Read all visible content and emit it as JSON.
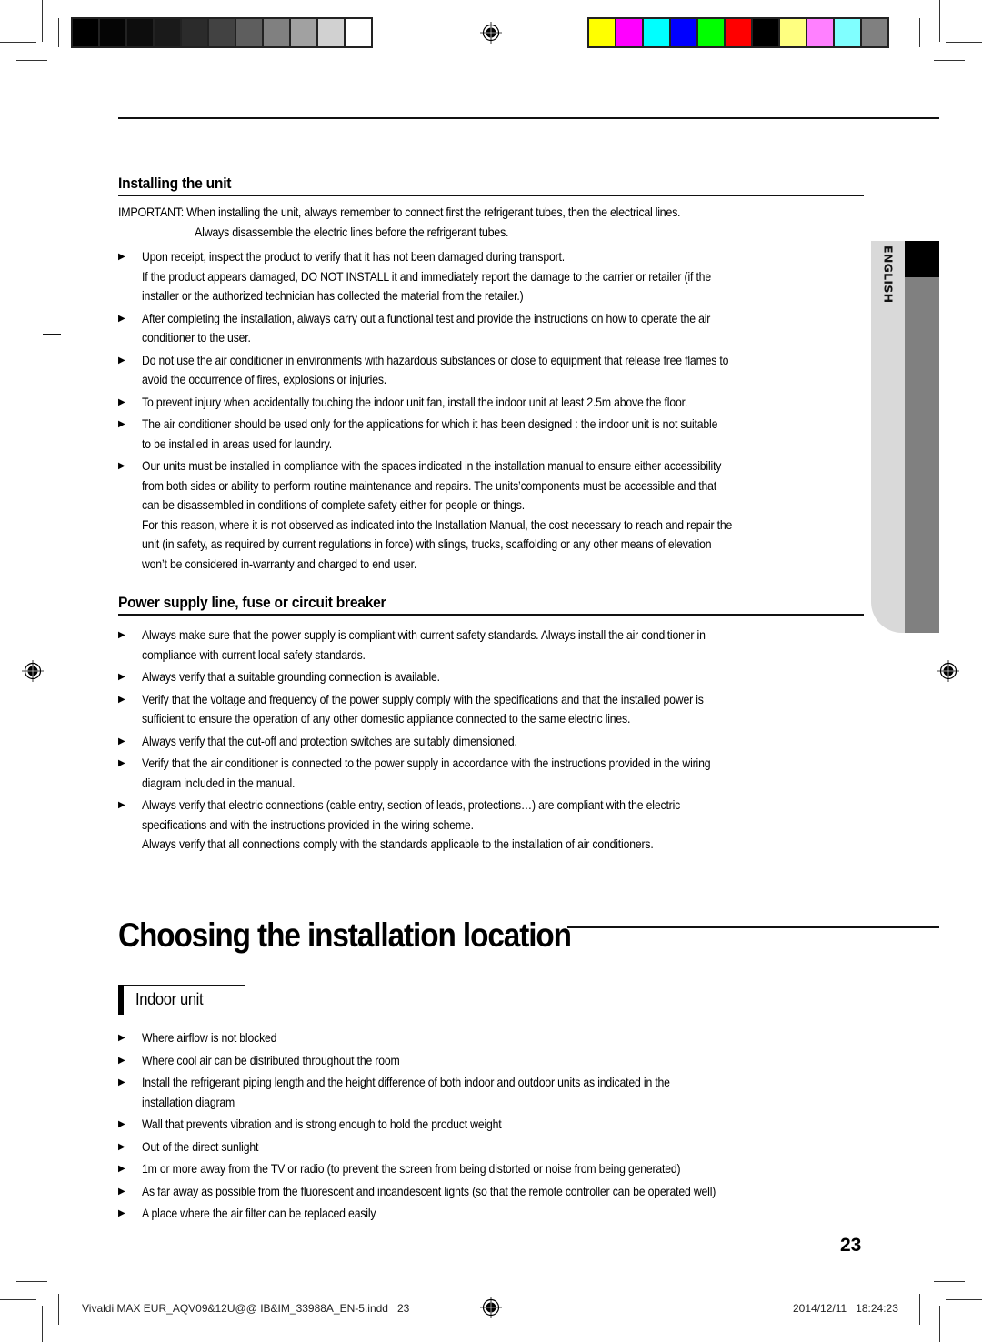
{
  "print_marks": {
    "grayscale_swatches": [
      "#000000",
      "#050505",
      "#0d0d0d",
      "#1a1a1a",
      "#2b2b2b",
      "#424242",
      "#5e5e5e",
      "#808080",
      "#a1a1a1",
      "#d1d1d1",
      "#ffffff"
    ],
    "color_swatches": [
      "#ffff00",
      "#ff00ff",
      "#00ffff",
      "#0000ff",
      "#00ff00",
      "#ff0000",
      "#000000",
      "#ffff80",
      "#ff80ff",
      "#80ffff",
      "#808080"
    ]
  },
  "side_tab": {
    "label": "ENGLISH"
  },
  "section_installing": {
    "heading": "Installing the unit",
    "important_line1": "IMPORTANT: When installing the unit, always remember to connect first the refrigerant tubes, then the electrical lines.",
    "important_line2": "Always disassemble the electric lines before the refrigerant tubes.",
    "items": [
      {
        "lines": [
          "Upon receipt, inspect the product to verify that it has not been damaged during transport.",
          "If the product appears damaged, DO NOT INSTALL it and immediately report the damage to the carrier or retailer (if the",
          "installer or the authorized technician has collected the material from the retailer.)"
        ]
      },
      {
        "lines": [
          "After completing the installation, always carry out a functional test and provide the instructions on how to operate the air",
          "conditioner to the user."
        ]
      },
      {
        "lines": [
          "Do not use the air conditioner in environments with hazardous substances or close to equipment that release free flames to",
          "avoid the occurrence of fires, explosions or injuries."
        ]
      },
      {
        "lines": [
          "To prevent injury when accidentally touching the indoor unit fan, install the indoor unit at least 2.5m above the floor."
        ]
      },
      {
        "lines": [
          "The air conditioner should be used only for the applications for which it has been designed : the indoor unit is not suitable",
          "to be installed in areas used for laundry."
        ]
      },
      {
        "lines": [
          "Our units must be installed in compliance with the spaces indicated in the installation manual to ensure either accessibility",
          "from both sides or ability to perform routine maintenance and repairs. The units’components must be accessible and that",
          "can be disassembled in conditions of complete safety either for people or things.",
          "For this reason, where it is not observed as indicated into the Installation Manual, the cost necessary to reach and repair the",
          "unit (in safety, as required by current regulations in force) with slings, trucks, scaffolding or any other means of elevation",
          "won’t be considered in-warranty and charged to end user."
        ]
      }
    ]
  },
  "section_power": {
    "heading": "Power supply line, fuse or circuit breaker",
    "items": [
      {
        "lines": [
          "Always make sure that the power supply is compliant with current safety standards. Always install the air conditioner in",
          "compliance with current local safety standards."
        ]
      },
      {
        "lines": [
          "Always verify that a suitable grounding connection is available."
        ]
      },
      {
        "lines": [
          "Verify that the voltage and frequency of the power supply comply with the specifications and that the installed power is",
          "sufficient to ensure the operation of any other domestic appliance connected to the same electric lines."
        ]
      },
      {
        "lines": [
          "Always verify that the cut-off and protection switches are suitably dimensioned."
        ]
      },
      {
        "lines": [
          "Verify that the air conditioner is connected to the power supply in accordance with the instructions provided in the wiring",
          "diagram included in the manual."
        ]
      },
      {
        "lines": [
          "Always verify that electric connections (cable entry, section of leads, protections…) are compliant with the electric",
          "specifications and with the instructions provided in the wiring scheme.",
          "Always verify that all connections comply with the standards applicable to the installation of air conditioners."
        ]
      }
    ]
  },
  "chapter": {
    "title": "Choosing the installation location",
    "subsection": "Indoor unit",
    "items": [
      {
        "lines": [
          "Where airflow is not blocked"
        ]
      },
      {
        "lines": [
          "Where cool air can be distributed throughout the room"
        ]
      },
      {
        "lines": [
          "Install the refrigerant piping length and the height difference of both indoor and outdoor units as indicated in the",
          "installation diagram"
        ]
      },
      {
        "lines": [
          "Wall that prevents vibration and is strong enough to hold the product weight"
        ]
      },
      {
        "lines": [
          "Out of the direct sunlight"
        ]
      },
      {
        "lines": [
          "1m or more away from the TV or radio (to prevent the screen from being distorted or noise from being generated)"
        ]
      },
      {
        "lines": [
          "As far away as possible from the fluorescent and incandescent lights (so that the remote controller can be operated well)"
        ]
      },
      {
        "lines": [
          "A place where the air filter can be replaced easily"
        ]
      }
    ]
  },
  "page_number": "23",
  "footer": {
    "file_name": "Vivaldi MAX EUR_AQV09&12U@@ IB&IM_33988A_EN-5.indd   23",
    "timestamp": "2014/12/11   18:24:23"
  },
  "bullet_glyph": "▶"
}
